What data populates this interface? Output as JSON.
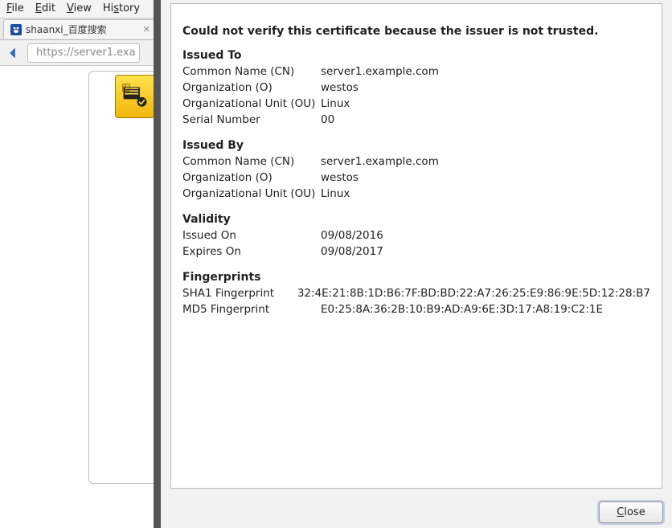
{
  "menubar": {
    "file": "File",
    "edit": "Edit",
    "view": "View",
    "history": "History"
  },
  "tab": {
    "title": "shaanxi_百度搜索"
  },
  "url": "https://server1.exa",
  "dialog": {
    "message": "Could not verify this certificate because the issuer is not trusted.",
    "issued_to_head": "Issued To",
    "issued_by_head": "Issued By",
    "validity_head": "Validity",
    "fingerprints_head": "Fingerprints",
    "labels": {
      "cn": "Common Name (CN)",
      "o": "Organization (O)",
      "ou": "Organizational Unit (OU)",
      "serial": "Serial Number",
      "issued_on": "Issued On",
      "expires_on": "Expires On",
      "sha1": "SHA1 Fingerprint",
      "md5": "MD5 Fingerprint"
    },
    "issued_to": {
      "cn": "server1.example.com",
      "o": "westos",
      "ou": "Linux",
      "serial": "00"
    },
    "issued_by": {
      "cn": "server1.example.com",
      "o": "westos",
      "ou": "Linux"
    },
    "validity": {
      "issued_on": "09/08/2016",
      "expires_on": "09/08/2017"
    },
    "fingerprints": {
      "sha1": "32:4E:21:8B:1D:B6:7F:BD:BD:22:A7:26:25:E9:86:9E:5D:12:28:B7",
      "md5": "E0:25:8A:36:2B:10:B9:AD:A9:6E:3D:17:A8:19:C2:1E"
    },
    "close_label": "Close"
  }
}
